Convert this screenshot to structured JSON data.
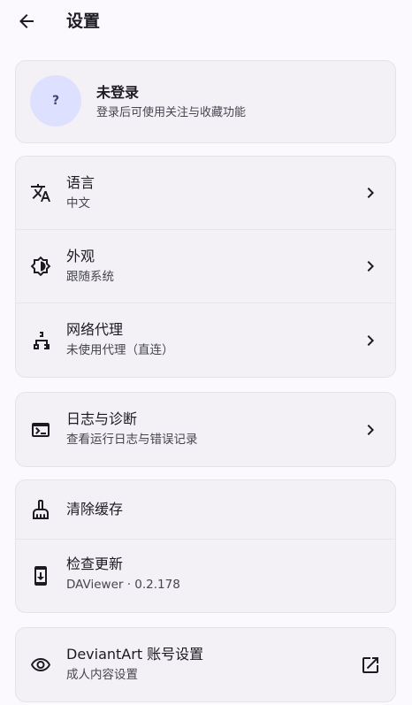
{
  "header": {
    "title": "设置",
    "back_icon": "arrow-back-icon"
  },
  "account": {
    "avatar_text": "?",
    "title": "未登录",
    "subtitle": "登录后可使用关注与收藏功能"
  },
  "general": {
    "items": [
      {
        "icon": "translate-icon",
        "title": "语言",
        "subtitle": "中文"
      },
      {
        "icon": "brightness-icon",
        "title": "外观",
        "subtitle": "跟随系统"
      },
      {
        "icon": "network-icon",
        "title": "网络代理",
        "subtitle": "未使用代理（直连）"
      }
    ]
  },
  "logs": {
    "items": [
      {
        "icon": "terminal-icon",
        "title": "日志与诊断",
        "subtitle": "查看运行日志与错误记录"
      }
    ]
  },
  "maintenance": {
    "items": [
      {
        "icon": "broom-icon",
        "title": "清除缓存"
      },
      {
        "icon": "system-update-icon",
        "title": "检查更新",
        "subtitle": "DAViewer · 0.2.178"
      }
    ]
  },
  "deviantart": {
    "items": [
      {
        "icon": "eye-icon",
        "title": "DeviantArt 账号设置",
        "subtitle": "成人内容设置",
        "trail_icon": "open-external-icon"
      }
    ]
  },
  "colors": {
    "background": "#fbf8fe",
    "card": "#f3f0f6",
    "avatar": "#dde1ff",
    "text": "#1b1b21",
    "subtext": "#46464f"
  }
}
